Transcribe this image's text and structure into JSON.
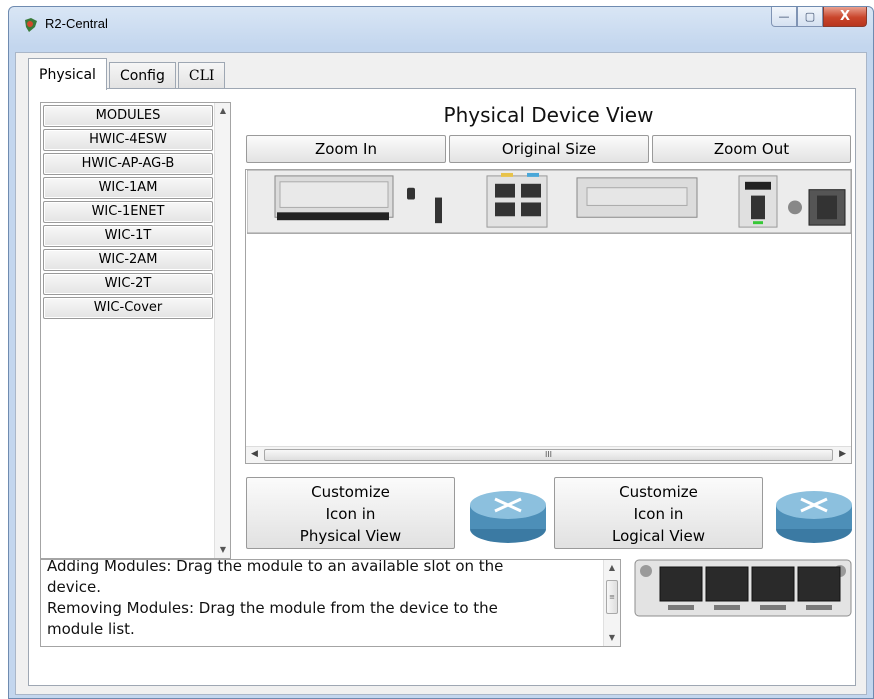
{
  "window": {
    "title": "R2-Central",
    "icon": "router-app-icon",
    "controls": [
      "minimize-icon",
      "maximize-icon",
      "close-icon"
    ],
    "minimize_glyph": "—",
    "maximize_glyph": "▢",
    "close_glyph": "X"
  },
  "tabs": [
    {
      "label": "Physical",
      "active": true
    },
    {
      "label": "Config",
      "active": false
    },
    {
      "label": "CLI",
      "active": false
    }
  ],
  "modules": {
    "items": [
      "MODULES",
      "HWIC-4ESW",
      "HWIC-AP-AG-B",
      "WIC-1AM",
      "WIC-1ENET",
      "WIC-1T",
      "WIC-2AM",
      "WIC-2T",
      "WIC-Cover"
    ]
  },
  "physical_view": {
    "title": "Physical Device View",
    "zoom_in": "Zoom In",
    "original_size": "Original Size",
    "zoom_out": "Zoom Out",
    "scroll_thumb_glyph": "III"
  },
  "customize": {
    "physical": [
      "Customize",
      "Icon in",
      "Physical View"
    ],
    "logical": [
      "Customize",
      "Icon in",
      "Logical View"
    ]
  },
  "info": {
    "lines": [
      "Adding Modules: Drag the module to an available slot on the",
      " device.",
      "Removing Modules: Drag the module from the device to the",
      " module list."
    ]
  },
  "colors": {
    "title_bar": "#c3d6ee",
    "close_button": "#c9452b",
    "router_icon": "#4d8fb8"
  }
}
